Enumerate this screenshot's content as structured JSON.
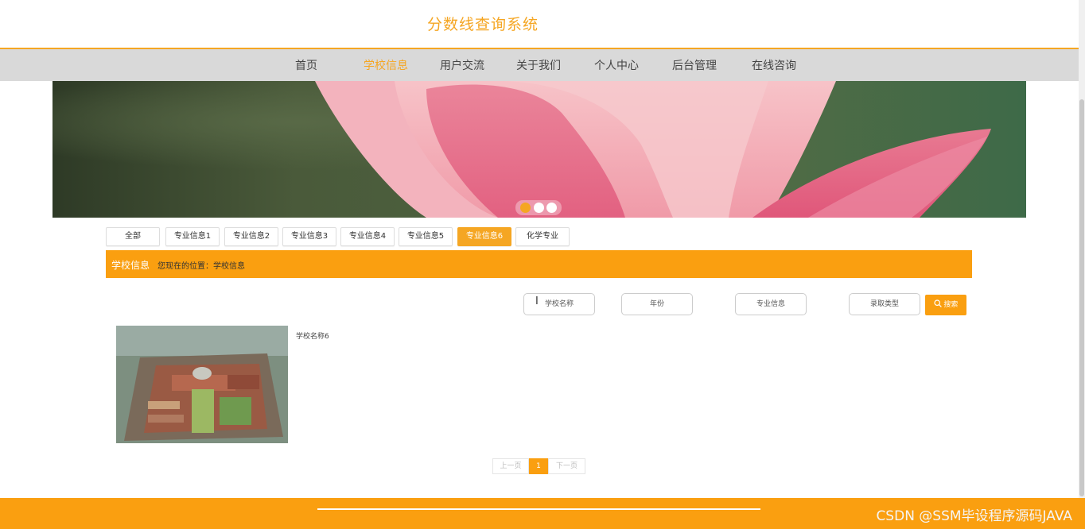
{
  "site": {
    "title": "分数线查询系统"
  },
  "nav": {
    "items": [
      {
        "label": "首页"
      },
      {
        "label": "学校信息"
      },
      {
        "label": "用户交流"
      },
      {
        "label": "关于我们"
      },
      {
        "label": "个人中心"
      },
      {
        "label": "后台管理"
      },
      {
        "label": "在线咨询"
      }
    ],
    "active": "学校信息"
  },
  "banner": {
    "slide_count": 3,
    "active_slide": 1,
    "icon": "lotus-flower-photo"
  },
  "tabs": [
    {
      "label": "全部"
    },
    {
      "label": "专业信息1"
    },
    {
      "label": "专业信息2"
    },
    {
      "label": "专业信息3"
    },
    {
      "label": "专业信息4"
    },
    {
      "label": "专业信息5"
    },
    {
      "label": "专业信息6"
    },
    {
      "label": "化学专业"
    }
  ],
  "active_tab": "专业信息6",
  "breadcrumb": {
    "title": "学校信息",
    "location": "您现在的位置：学校信息"
  },
  "search": {
    "school_name_placeholder": "学校名称",
    "year_placeholder": "年份",
    "major_placeholder": "专业信息",
    "admission_type_placeholder": "录取类型",
    "button_label": "搜索",
    "button_icon": "search-icon"
  },
  "results": [
    {
      "name": "学校名称6",
      "image": "campus-aerial-photo"
    }
  ],
  "pagination": {
    "prev": "上一页",
    "current": "1",
    "next": "下一页"
  },
  "footer": {
    "watermark": "CSDN @SSM毕设程序源码JAVA"
  },
  "colors": {
    "accent": "#fa9f10",
    "nav_bg": "#d9d9d9",
    "title": "#f5a623"
  }
}
